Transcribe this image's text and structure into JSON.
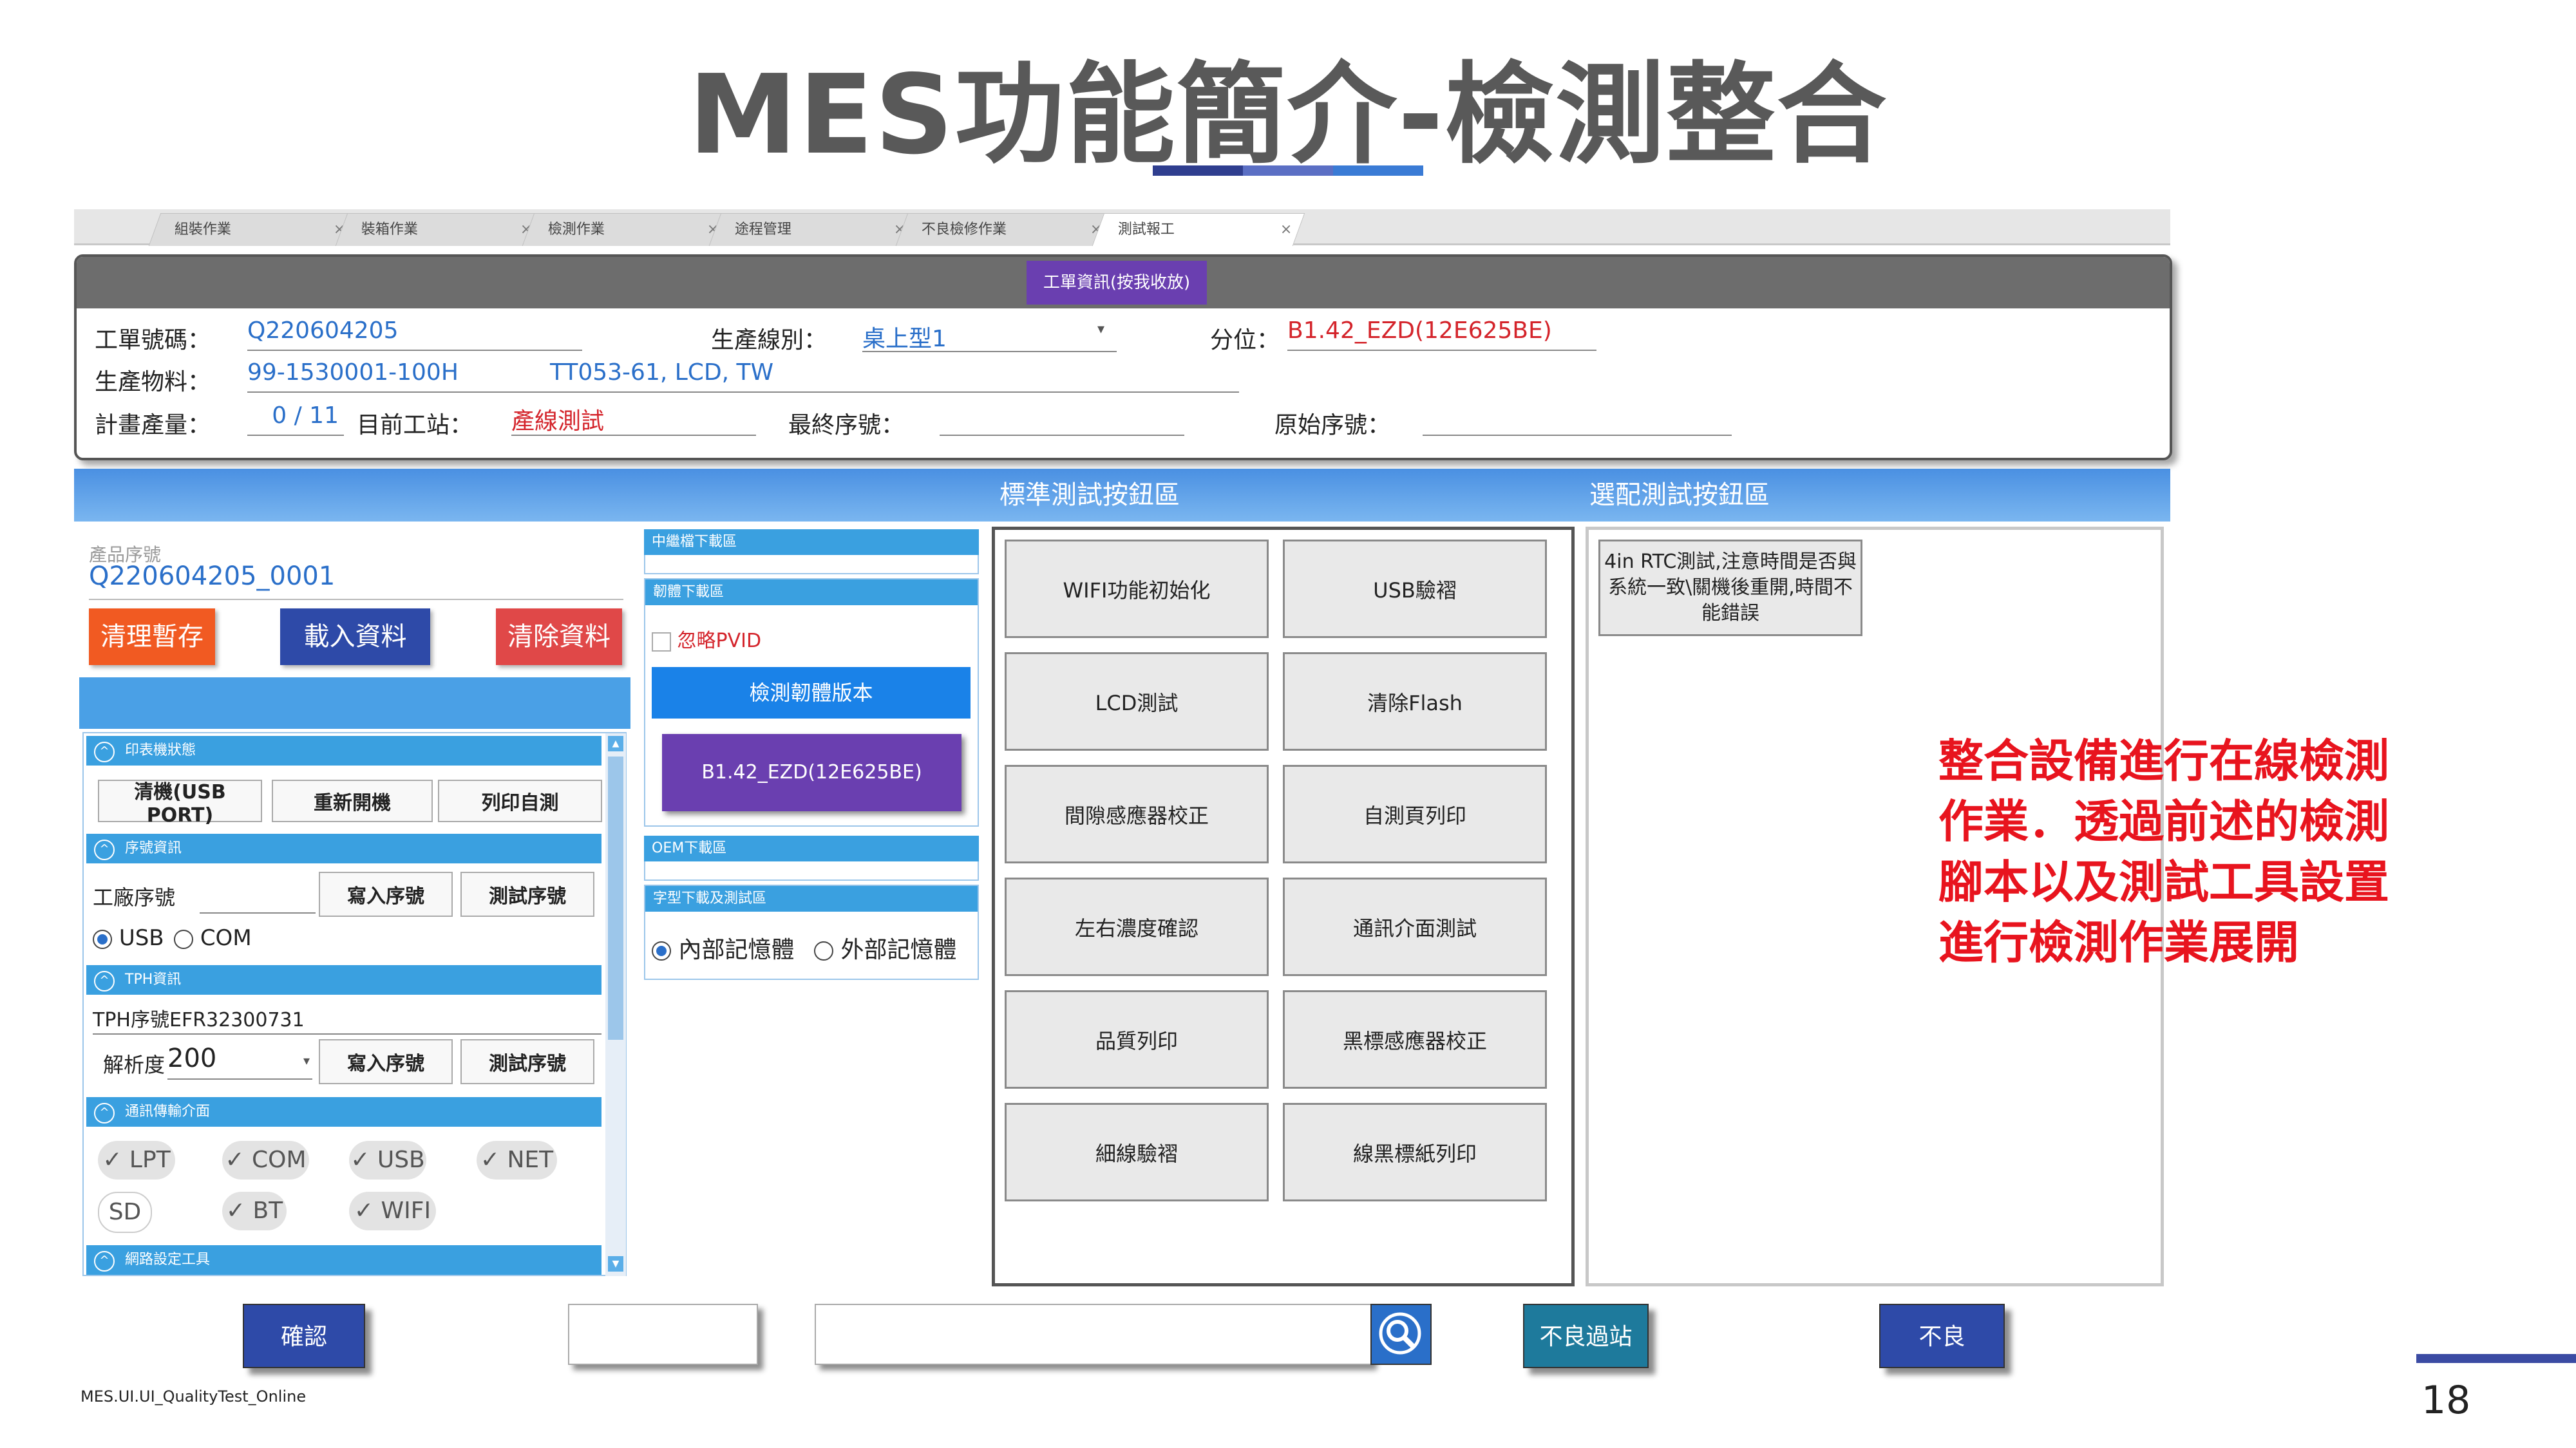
{
  "slide": {
    "title": "MES功能簡介-檢測整合",
    "page_number": "18",
    "footer_app": "MES.UI.UI_QualityTest_Online",
    "caption": "整合設備進行在線檢測作業．透過前述的檢測腳本以及測試工具設置進行檢測作業展開",
    "accent_colors": [
      "#2f3e8f",
      "#3a7bd5"
    ]
  },
  "tabs": [
    "組裝作業",
    "裝箱作業",
    "檢測作業",
    "途程管理",
    "不良檢修作業",
    "測試報工"
  ],
  "header": {
    "toggle_button": "工單資訊(按我收放)",
    "work_order_label": "工單號碼：",
    "work_order_value": "Q220604205",
    "line_label": "生產線別：",
    "line_value": "桌上型1",
    "position_label": "分位：",
    "position_value": "B1.42_EZD(12E625BE)",
    "material_label": "生產物料：",
    "material_value": "99-1530001-100H",
    "material_desc": "TT053-61, LCD, TW",
    "plan_qty_label": "計畫產量：",
    "plan_qty_value": "0 / 11",
    "station_label": "目前工站：",
    "station_value": "產線測試",
    "final_sn_label": "最終序號：",
    "final_sn_value": "",
    "orig_sn_label": "原始序號：",
    "orig_sn_value": ""
  },
  "bands": {
    "standard_title": "標準測試按鈕區",
    "optional_title": "選配測試按鈕區"
  },
  "left": {
    "serial_label": "產品序號",
    "serial_value": "Q220604205_0001",
    "clear_cache": "清理暫存",
    "load_data": "載入資料",
    "clear_data": "清除資料",
    "printer_section": "印表機狀態",
    "clear_usb": "清機(USB PORT)",
    "reboot": "重新開機",
    "print_selftest": "列印自測",
    "serial_section": "序號資訊",
    "factory_sn_label": "工廠序號",
    "write_sn": "寫入序號",
    "test_sn": "測試序號",
    "usb_option": "USB",
    "com_option": "COM",
    "tph_section": "TPH資訊",
    "tph_sn_label": "TPH序號",
    "tph_sn_value": "EFR32300731",
    "resolution_label": "解析度",
    "resolution_value": "200",
    "comm_section": "通訊傳輸介面",
    "comm_items": [
      {
        "label": "LPT",
        "checked": true
      },
      {
        "label": "COM",
        "checked": true
      },
      {
        "label": "USB",
        "checked": true
      },
      {
        "label": "NET",
        "checked": true
      },
      {
        "label": "SD",
        "checked": false
      },
      {
        "label": "BT",
        "checked": true
      },
      {
        "label": "WIFI",
        "checked": true
      }
    ],
    "network_section": "網路設定工具"
  },
  "mid": {
    "relay_section": "中繼檔下載區",
    "firmware_section": "韌體下載區",
    "ignore_pvid": "忽略PVID",
    "check_fw": "檢測韌體版本",
    "fw_version": "B1.42_EZD(12E625BE)",
    "oem_section": "OEM下載區",
    "font_section": "字型下載及測試區",
    "internal_mem": "內部記憶體",
    "external_mem": "外部記憶體"
  },
  "standard_buttons": [
    "WIFI功能初始化",
    "USB驗褶",
    "LCD測試",
    "清除Flash",
    "間隙感應器校正",
    "自測頁列印",
    "左右濃度確認",
    "通訊介面測試",
    "品質列印",
    "黑標感應器校正",
    "細線驗褶",
    "線黑標紙列印"
  ],
  "optional_buttons": [
    "4in RTC測試,注意時間是否與系統一致\\關機後重開,時間不能錯誤"
  ],
  "bottom": {
    "confirm": "確認",
    "search_placeholder": "",
    "reject_pass": "不良過站",
    "reject": "不良"
  }
}
